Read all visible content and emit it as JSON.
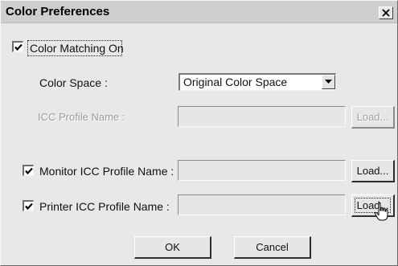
{
  "window": {
    "title": "Color Preferences",
    "close_glyph": "×"
  },
  "color_matching": {
    "label": "Color Matching On",
    "checked": true
  },
  "color_space": {
    "label": "Color Space :",
    "selected": "Original Color Space"
  },
  "icc_profile": {
    "label": "ICC Profile Name :",
    "value": "",
    "load_label": "Load..."
  },
  "monitor_profile": {
    "label": "Monitor ICC Profile Name :",
    "checked": true,
    "value": "",
    "load_label": "Load..."
  },
  "printer_profile": {
    "label": "Printer ICC Profile Name :",
    "checked": true,
    "value": "",
    "load_label": "Load..."
  },
  "buttons": {
    "ok": "OK",
    "cancel": "Cancel"
  }
}
